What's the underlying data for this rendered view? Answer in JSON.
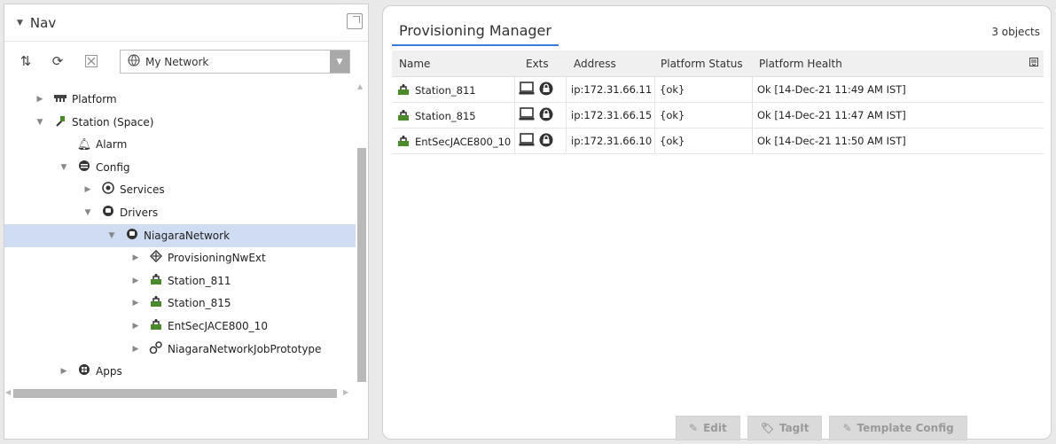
{
  "nav": {
    "title": "Nav",
    "network_select": "My Network",
    "tree": [
      {
        "label": "Platform",
        "icon": "platform-icon",
        "depth": 0,
        "expander": "collapsed"
      },
      {
        "label": "Station (Space)",
        "icon": "station-plug-icon",
        "depth": 0,
        "expander": "expanded"
      },
      {
        "label": "Alarm",
        "icon": "bell-icon",
        "depth": 1,
        "expander": "none"
      },
      {
        "label": "Config",
        "icon": "database-icon",
        "depth": 1,
        "expander": "expanded"
      },
      {
        "label": "Services",
        "icon": "services-icon",
        "depth": 2,
        "expander": "collapsed"
      },
      {
        "label": "Drivers",
        "icon": "drivers-icon",
        "depth": 2,
        "expander": "expanded"
      },
      {
        "label": "NiagaraNetwork",
        "icon": "network-icon",
        "depth": 3,
        "expander": "expanded",
        "selected": true
      },
      {
        "label": "ProvisioningNwExt",
        "icon": "provisioning-icon",
        "depth": 4,
        "expander": "collapsed"
      },
      {
        "label": "Station_811",
        "icon": "station-icon",
        "depth": 4,
        "expander": "collapsed"
      },
      {
        "label": "Station_815",
        "icon": "station-icon",
        "depth": 4,
        "expander": "collapsed"
      },
      {
        "label": "EntSecJACE800_10",
        "icon": "station-icon",
        "depth": 4,
        "expander": "collapsed"
      },
      {
        "label": "NiagaraNetworkJobPrototype",
        "icon": "job-gears-icon",
        "depth": 4,
        "expander": "collapsed"
      },
      {
        "label": "Apps",
        "icon": "apps-icon",
        "depth": 1,
        "expander": "collapsed"
      }
    ]
  },
  "main": {
    "tab_label": "Provisioning Manager",
    "object_count": "3 objects",
    "columns": [
      "Name",
      "Exts",
      "Address",
      "Platform Status",
      "Platform Health"
    ],
    "rows": [
      {
        "name": "Station_811",
        "address": "ip:172.31.66.11",
        "status": "{ok}",
        "health": "Ok [14-Dec-21 11:49 AM IST]"
      },
      {
        "name": "Station_815",
        "address": "ip:172.31.66.15",
        "status": "{ok}",
        "health": "Ok [14-Dec-21 11:47 AM IST]"
      },
      {
        "name": "EntSecJACE800_10",
        "address": "ip:172.31.66.10",
        "status": "{ok}",
        "health": "Ok [14-Dec-21 11:50 AM IST]"
      }
    ],
    "buttons": {
      "edit": "Edit",
      "tagit": "TagIt",
      "template_config": "Template Config"
    }
  },
  "colors": {
    "selection": "#cfdcf2",
    "tab_underline": "#3b7dd8",
    "station_green": "#4a8a2a"
  }
}
